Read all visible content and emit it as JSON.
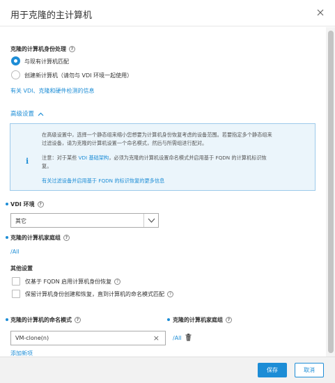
{
  "dialog": {
    "title": "用于克隆的主计算机"
  },
  "identity": {
    "heading": "克隆的计算机身份处理",
    "options": [
      {
        "label": "与现有计算机匹配",
        "selected": true
      },
      {
        "label": "创建新计算机（请勿与 VDI 环境一起使用）",
        "selected": false
      }
    ],
    "info_link": "有关 VDI、克隆和硬件检测的信息"
  },
  "advanced": {
    "label": "高级设置",
    "info_box": {
      "line1": "在高级设置中，选择一个静态组来缩小您想要为计算机身份恢复考虑的设备范围。若要指定多个静态组来",
      "line2": "过滤设备，请为克隆的计算机设置一个命名模式，然后与所需组进行配对。",
      "note_prefix": "注意：对于某些 ",
      "note_link": "VDI 基础架构",
      "note_suffix": "，必须为克隆的计算机设置命名模式并启用基于 FQDN 的计算机标识恢",
      "note_line2": "复。",
      "fqdn_link": "有关过滤设备并启用基于 FQDN 的标识恢复的更多信息"
    }
  },
  "vdi": {
    "label": "VDI 环境",
    "selected": "其它"
  },
  "home_group": {
    "label": "克隆的计算机家庭组",
    "value": "/All"
  },
  "other_settings": {
    "heading": "其他设置",
    "checkboxes": [
      {
        "label": "仅基于 FQDN 启用计算机身份恢复",
        "checked": false
      },
      {
        "label": "保留计算机身份创建和恢复，直到计算机的命名模式匹配",
        "checked": false
      }
    ]
  },
  "naming": {
    "pattern_label": "克隆的计算机的命名模式",
    "pattern_value": "VM-clone(n)",
    "group_label": "克隆的计算机家庭组",
    "group_value": "/All",
    "add_link": "添加新项"
  },
  "footer": {
    "save": "保存",
    "cancel": "取消"
  },
  "colors": {
    "accent": "#1d8dd6",
    "info_bg": "#ebf5fb",
    "info_border": "#9cc9ea"
  }
}
